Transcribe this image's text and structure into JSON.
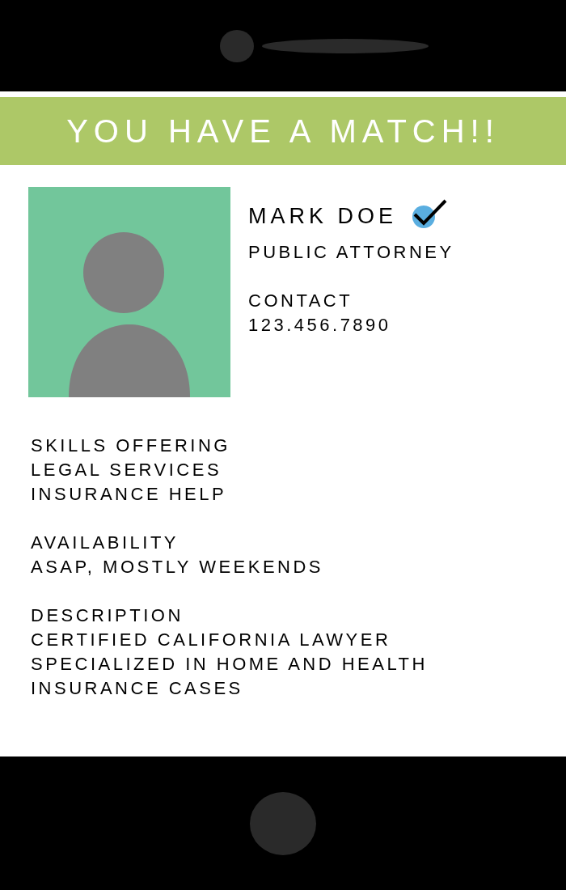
{
  "banner": {
    "title": "YOU HAVE A MATCH!!"
  },
  "profile": {
    "name": "MARK DOE",
    "verified": true,
    "role": "PUBLIC ATTORNEY",
    "contact_label": "CONTACT",
    "phone": "123.456.7890"
  },
  "sections": [
    {
      "heading": "SKILLS OFFERING",
      "items": [
        "LEGAL SERVICES",
        "INSURANCE HELP"
      ]
    },
    {
      "heading": "AVAILABILITY",
      "text": "ASAP, MOSTLY WEEKENDS"
    },
    {
      "heading": "DESCRIPTION",
      "text": "CERTIFIED CALIFORNIA LAWYER SPECIALIZED IN HOME AND HEALTH INSURANCE CASES"
    }
  ]
}
